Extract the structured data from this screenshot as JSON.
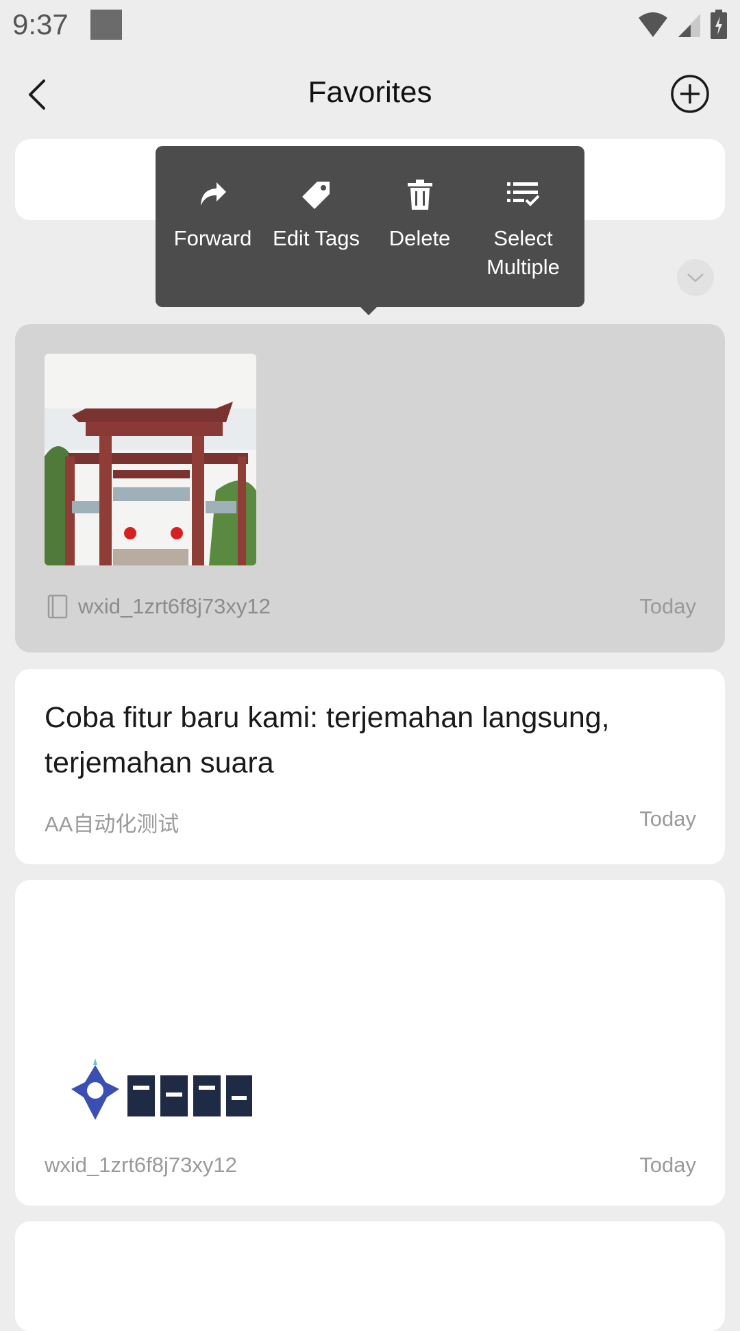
{
  "status_bar": {
    "time": "9:37"
  },
  "header": {
    "title": "Favorites"
  },
  "popup_menu": {
    "items": [
      {
        "label": "Forward",
        "icon": "forward-icon"
      },
      {
        "label": "Edit Tags",
        "icon": "tag-icon"
      },
      {
        "label": "Delete",
        "icon": "trash-icon"
      },
      {
        "label": "Select Multiple",
        "icon": "select-multiple-icon"
      }
    ]
  },
  "favorites": [
    {
      "type": "image",
      "source": "wxid_1zrt6f8j73xy12",
      "time": "Today",
      "selected": true
    },
    {
      "type": "text",
      "text": "Coba fitur baru kami: terjemahan langsung, terjemahan suara",
      "source": "AA自动化测试",
      "time": "Today"
    },
    {
      "type": "image",
      "source": "wxid_1zrt6f8j73xy12",
      "time": "Today"
    }
  ],
  "colors": {
    "background": "#ededed",
    "card": "#ffffff",
    "selected_card": "#d4d4d4",
    "popup": "#4c4c4c"
  }
}
